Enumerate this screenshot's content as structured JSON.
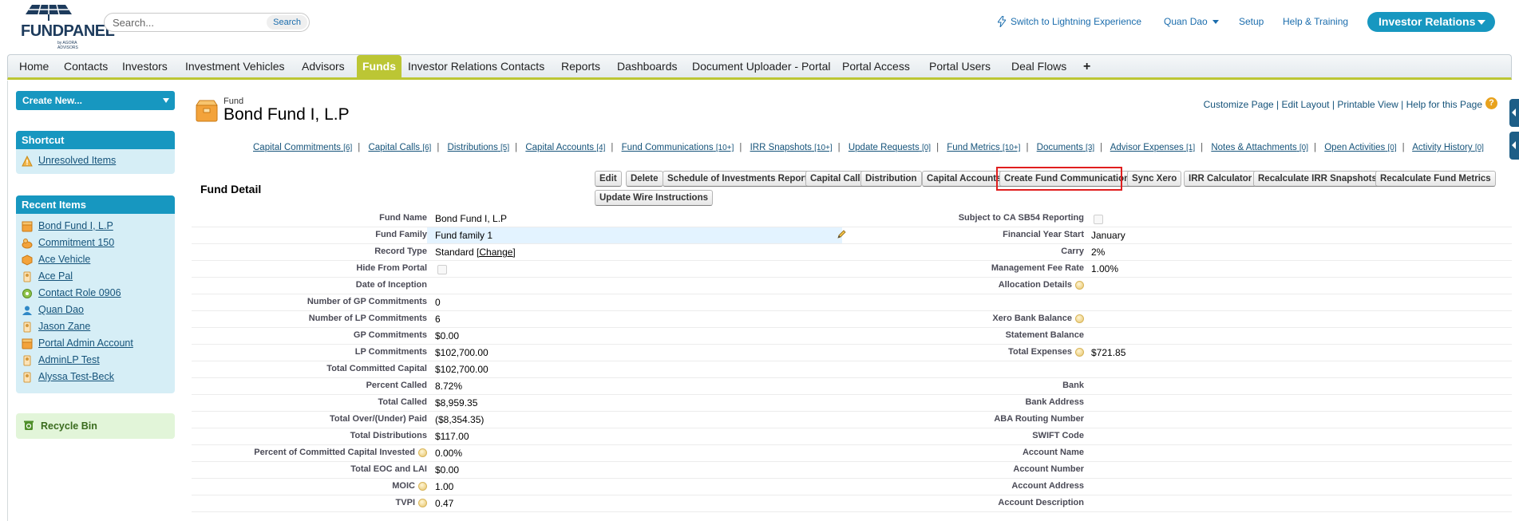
{
  "header": {
    "logo_text": "FUNDPANEL",
    "logo_sub": "by AGORA ADVISORS",
    "search_placeholder": "Search...",
    "search_button": "Search",
    "lightning_link": "Switch to Lightning Experience",
    "user_name": "Quan Dao",
    "setup": "Setup",
    "help": "Help & Training",
    "app_menu": "Investor Relations"
  },
  "tabs": [
    {
      "label": "Home"
    },
    {
      "label": "Contacts"
    },
    {
      "label": "Investors"
    },
    {
      "label": "Investment Vehicles"
    },
    {
      "label": "Advisors"
    },
    {
      "label": "Funds",
      "active": true
    },
    {
      "label": "Investor Relations Contacts"
    },
    {
      "label": "Reports"
    },
    {
      "label": "Dashboards"
    },
    {
      "label": "Document Uploader - Portal"
    },
    {
      "label": "Portal Access"
    },
    {
      "label": "Portal Users"
    },
    {
      "label": "Deal Flows"
    },
    {
      "label": "+"
    }
  ],
  "sidebar": {
    "create_new": "Create New...",
    "shortcut_title": "Shortcut",
    "shortcut_items": [
      {
        "label": "Unresolved Items",
        "icon": "warning-icon"
      }
    ],
    "recent_title": "Recent Items",
    "recent_items": [
      {
        "label": "Bond Fund I, L.P",
        "icon": "fund-icon"
      },
      {
        "label": "Commitment 150",
        "icon": "commitment-icon"
      },
      {
        "label": "Ace Vehicle",
        "icon": "vehicle-icon"
      },
      {
        "label": "Ace Pal",
        "icon": "advisor-icon"
      },
      {
        "label": "Contact Role 0906",
        "icon": "gear-icon"
      },
      {
        "label": "Quan Dao",
        "icon": "person-icon"
      },
      {
        "label": "Jason Zane",
        "icon": "advisor-icon"
      },
      {
        "label": "Portal Admin Account",
        "icon": "fund-icon"
      },
      {
        "label": "AdminLP Test",
        "icon": "advisor-icon"
      },
      {
        "label": "Alyssa Test-Beck",
        "icon": "advisor-icon"
      }
    ],
    "recycle_bin": "Recycle Bin"
  },
  "record": {
    "type": "Fund",
    "title": "Bond Fund I, L.P",
    "page_links": [
      "Customize Page",
      "Edit Layout",
      "Printable View",
      "Help for this Page"
    ]
  },
  "related_lists": [
    {
      "label": "Capital Commitments",
      "count": "[6]"
    },
    {
      "label": "Capital Calls",
      "count": "[6]"
    },
    {
      "label": "Distributions",
      "count": "[5]"
    },
    {
      "label": "Capital Accounts",
      "count": "[4]"
    },
    {
      "label": "Fund Communications",
      "count": "[10+]"
    },
    {
      "label": "IRR Snapshots",
      "count": "[10+]"
    },
    {
      "label": "Update Requests",
      "count": "[0]"
    },
    {
      "label": "Fund Metrics",
      "count": "[10+]"
    },
    {
      "label": "Documents",
      "count": "[3]"
    },
    {
      "label": "Advisor Expenses",
      "count": "[1]"
    },
    {
      "label": "Notes & Attachments",
      "count": "[0]"
    },
    {
      "label": "Open Activities",
      "count": "[0]"
    },
    {
      "label": "Activity History",
      "count": "[0]"
    }
  ],
  "detail": {
    "title": "Fund Detail",
    "buttons": [
      "Edit",
      "Delete",
      "Schedule of Investments Report",
      "Capital Call",
      "Distribution",
      "Capital Accounts",
      "Create Fund Communication",
      "Sync Xero",
      "IRR Calculator",
      "Recalculate IRR Snapshots",
      "Recalculate Fund Metrics",
      "Update Wire Instructions"
    ],
    "highlighted_button": "Create Fund Communication",
    "left": [
      {
        "label": "Fund Name",
        "value": "Bond Fund I, L.P"
      },
      {
        "label": "Fund Family",
        "value": "Fund family 1"
      },
      {
        "label": "Record Type",
        "value": "Standard",
        "link": "[Change]"
      },
      {
        "label": "Hide From Portal",
        "value": ""
      },
      {
        "label": "Date of Inception",
        "value": ""
      },
      {
        "label": "Number of GP Commitments",
        "value": "0"
      },
      {
        "label": "Number of LP Commitments",
        "value": "6"
      },
      {
        "label": "GP Commitments",
        "value": "$0.00"
      },
      {
        "label": "LP Commitments",
        "value": "$102,700.00"
      },
      {
        "label": "Total Committed Capital",
        "value": "$102,700.00"
      },
      {
        "label": "Percent Called",
        "value": "8.72%"
      },
      {
        "label": "Total Called",
        "value": "$8,959.35"
      },
      {
        "label": "Total Over/(Under) Paid",
        "value": "($8,354.35)"
      },
      {
        "label": "Total Distributions",
        "value": "$117.00"
      },
      {
        "label": "Percent of Committed Capital Invested",
        "value": "0.00%"
      },
      {
        "label": "Total EOC and LAI",
        "value": "$0.00"
      },
      {
        "label": "MOIC",
        "value": "1.00"
      },
      {
        "label": "TVPI",
        "value": "0.47"
      }
    ],
    "right": [
      {
        "label": "Subject to CA SB54 Reporting",
        "value": ""
      },
      {
        "label": "Financial Year Start",
        "value": "January"
      },
      {
        "label": "Carry",
        "value": "2%"
      },
      {
        "label": "Management Fee Rate",
        "value": "1.00%"
      },
      {
        "label": "Allocation Details",
        "value": ""
      },
      {
        "label": "",
        "value": ""
      },
      {
        "label": "Xero Bank Balance",
        "value": ""
      },
      {
        "label": "Statement Balance",
        "value": ""
      },
      {
        "label": "Total Expenses",
        "value": "$721.85"
      },
      {
        "label": "",
        "value": ""
      },
      {
        "label": "Bank",
        "value": ""
      },
      {
        "label": "Bank Address",
        "value": ""
      },
      {
        "label": "ABA Routing Number",
        "value": ""
      },
      {
        "label": "SWIFT Code",
        "value": ""
      },
      {
        "label": "Account Name",
        "value": ""
      },
      {
        "label": "Account Number",
        "value": ""
      },
      {
        "label": "Account Address",
        "value": ""
      },
      {
        "label": "Account Description",
        "value": ""
      }
    ]
  },
  "colors": {
    "accent": "#1797c0",
    "tab_active": "#bcc634",
    "highlight": "#e01e1e"
  }
}
